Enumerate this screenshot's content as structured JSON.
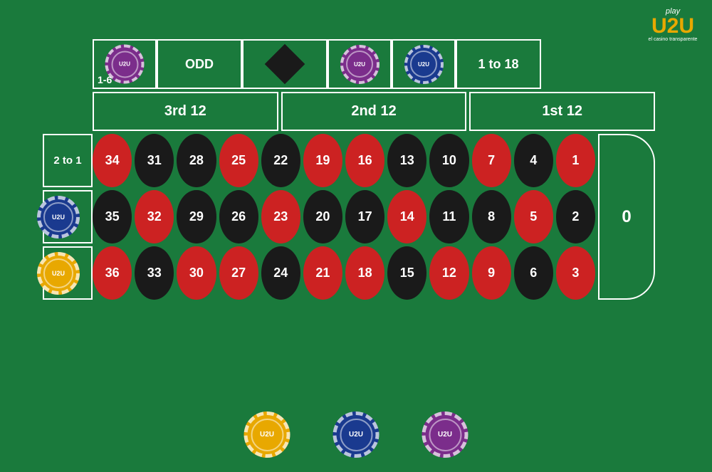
{
  "logo": {
    "play": "play",
    "brand": "U2U",
    "sub": "el casino transparente"
  },
  "top_row": [
    {
      "label": "1-6",
      "type": "chip-purple",
      "has_chip": true
    },
    {
      "label": "ODD",
      "has_chip": false
    },
    {
      "label": "♦",
      "is_diamond": true,
      "has_chip": false
    },
    {
      "label": "",
      "type": "chip-purple",
      "has_chip": true
    },
    {
      "label": "",
      "type": "chip-blue",
      "has_chip": true
    },
    {
      "label": "1 to 18",
      "has_chip": false
    }
  ],
  "dozens": [
    {
      "label": "3rd 12"
    },
    {
      "label": "2nd 12"
    },
    {
      "label": "1st 12"
    }
  ],
  "numbers": [
    {
      "n": 34,
      "color": "red",
      "row": 1,
      "col": 1
    },
    {
      "n": 31,
      "color": "black",
      "row": 1,
      "col": 2
    },
    {
      "n": 28,
      "color": "black",
      "row": 1,
      "col": 3
    },
    {
      "n": 25,
      "color": "red",
      "row": 1,
      "col": 4
    },
    {
      "n": 22,
      "color": "black",
      "row": 1,
      "col": 5
    },
    {
      "n": 19,
      "color": "red",
      "row": 1,
      "col": 6
    },
    {
      "n": 16,
      "color": "red",
      "row": 1,
      "col": 7
    },
    {
      "n": 13,
      "color": "black",
      "row": 1,
      "col": 8
    },
    {
      "n": 10,
      "color": "black",
      "row": 1,
      "col": 9
    },
    {
      "n": 7,
      "color": "red",
      "row": 1,
      "col": 10
    },
    {
      "n": 4,
      "color": "black",
      "row": 1,
      "col": 11
    },
    {
      "n": 1,
      "color": "red",
      "row": 1,
      "col": 12
    },
    {
      "n": 35,
      "color": "black",
      "row": 2,
      "col": 1
    },
    {
      "n": 32,
      "color": "red",
      "row": 2,
      "col": 2
    },
    {
      "n": 29,
      "color": "black",
      "row": 2,
      "col": 3
    },
    {
      "n": 26,
      "color": "black",
      "row": 2,
      "col": 4
    },
    {
      "n": 23,
      "color": "red",
      "row": 2,
      "col": 5
    },
    {
      "n": 20,
      "color": "black",
      "row": 2,
      "col": 6
    },
    {
      "n": 17,
      "color": "black",
      "row": 2,
      "col": 7
    },
    {
      "n": 14,
      "color": "red",
      "row": 2,
      "col": 8
    },
    {
      "n": 11,
      "color": "black",
      "row": 2,
      "col": 9
    },
    {
      "n": 8,
      "color": "black",
      "row": 2,
      "col": 10
    },
    {
      "n": 5,
      "color": "red",
      "row": 2,
      "col": 11
    },
    {
      "n": 2,
      "color": "black",
      "row": 2,
      "col": 12
    },
    {
      "n": 36,
      "color": "red",
      "row": 3,
      "col": 1
    },
    {
      "n": 33,
      "color": "black",
      "row": 3,
      "col": 2
    },
    {
      "n": 30,
      "color": "red",
      "row": 3,
      "col": 3
    },
    {
      "n": 27,
      "color": "red",
      "row": 3,
      "col": 4
    },
    {
      "n": 24,
      "color": "black",
      "row": 3,
      "col": 5
    },
    {
      "n": 21,
      "color": "red",
      "row": 3,
      "col": 6
    },
    {
      "n": 18,
      "color": "red",
      "row": 3,
      "col": 7
    },
    {
      "n": 15,
      "color": "black",
      "row": 3,
      "col": 8
    },
    {
      "n": 12,
      "color": "red",
      "row": 3,
      "col": 9
    },
    {
      "n": 9,
      "color": "red",
      "row": 3,
      "col": 10
    },
    {
      "n": 6,
      "color": "black",
      "row": 3,
      "col": 11
    },
    {
      "n": 3,
      "color": "red",
      "row": 3,
      "col": 12
    }
  ],
  "side_bet": {
    "label": "2 to 1"
  },
  "zero": {
    "label": "0"
  },
  "bottom_chips": [
    {
      "color": "yellow",
      "label": "U2U"
    },
    {
      "color": "blue",
      "label": "U2U"
    },
    {
      "color": "purple",
      "label": "U2U"
    }
  ]
}
